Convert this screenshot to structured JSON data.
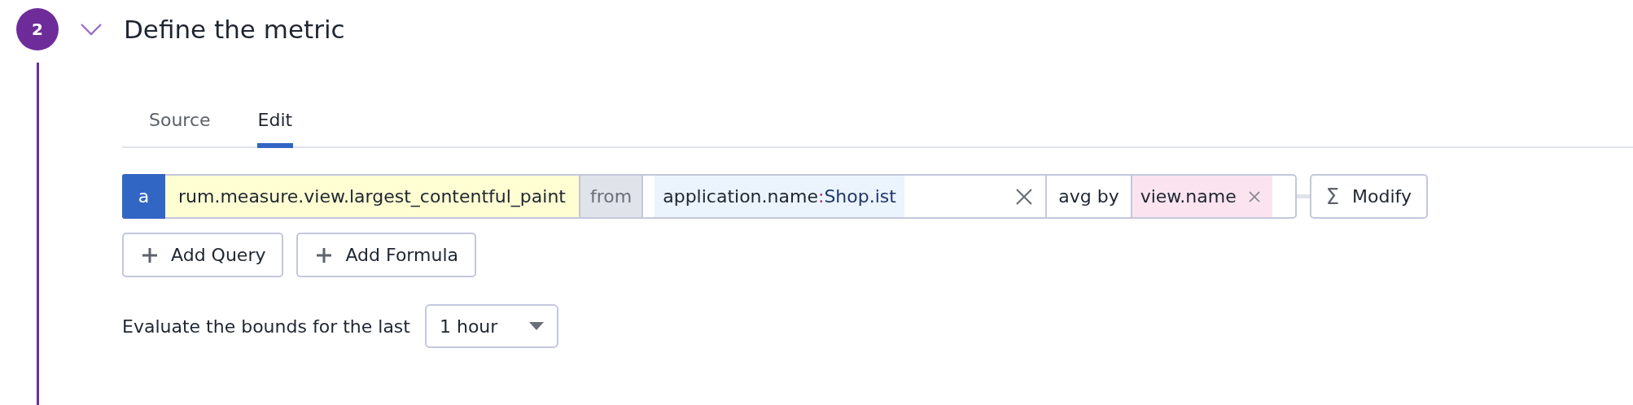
{
  "step": {
    "number": "2",
    "expanded": true,
    "title": "Define the metric"
  },
  "tabs": [
    {
      "label": "Source",
      "selected": false
    },
    {
      "label": "Edit",
      "selected": true
    }
  ],
  "query": {
    "letter": "a",
    "metric": "rum.measure.view.largest_contentful_paint",
    "from_label": "from",
    "filter": {
      "key": "application.name",
      "separator": ":",
      "value": "Shop.ist"
    },
    "aggregation": "avg by",
    "group_by": [
      {
        "tag": "view.name"
      }
    ]
  },
  "modify_button": {
    "symbol": "Σ",
    "label": "Modify"
  },
  "add_buttons": [
    "Add Query",
    "Add Formula"
  ],
  "evaluation": {
    "label": "Evaluate the bounds for the last",
    "timeframe": "1 hour"
  }
}
